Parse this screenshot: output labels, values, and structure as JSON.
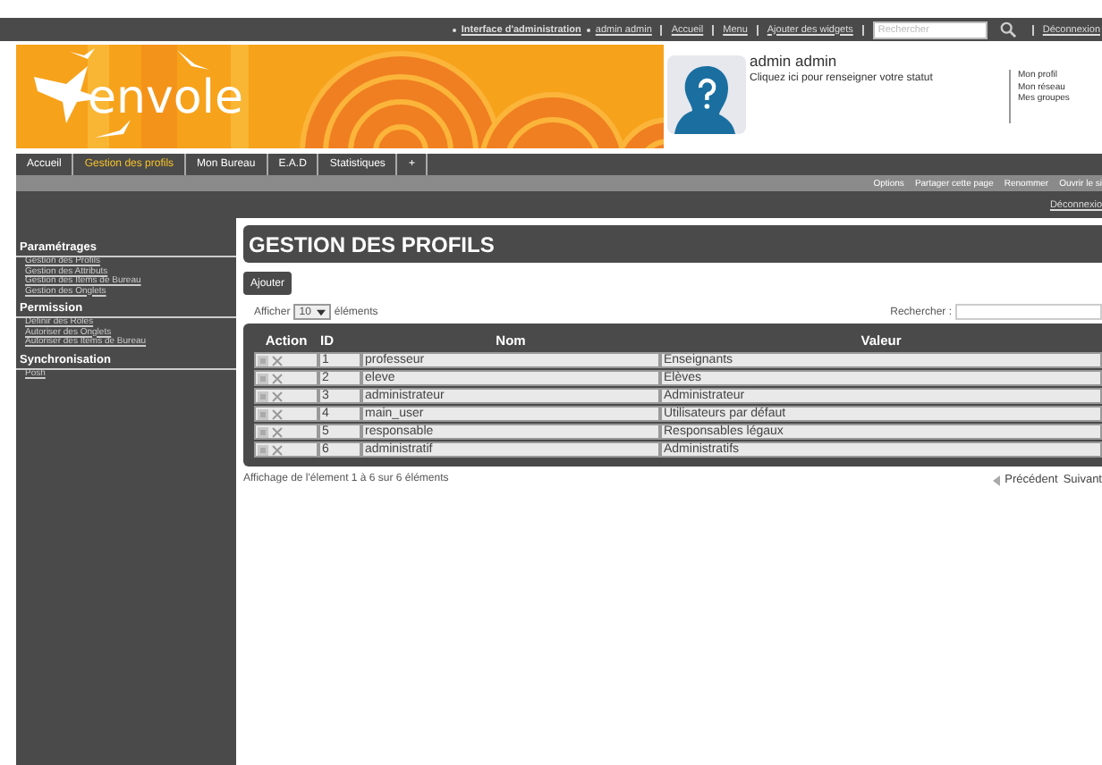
{
  "top_bar": {
    "links": [
      {
        "label": "Interface d'administration",
        "bold": true
      },
      {
        "label": "admin admin",
        "bold": false
      }
    ],
    "menu": [
      "Accueil",
      "Menu",
      "Ajouter des widgets"
    ],
    "search": {
      "placeholder": "Rechercher"
    },
    "logout": "Déconnexion"
  },
  "header": {
    "logo": "envole",
    "user_name": "admin admin",
    "status_prompt": "Cliquez ici pour renseigner votre statut",
    "user_links": [
      "Mon profil",
      "Mon réseau",
      "Mes groupes"
    ]
  },
  "tabs": [
    {
      "label": "Accueil",
      "selected": false
    },
    {
      "label": "Gestion des profils",
      "selected": true
    },
    {
      "label": "Mon Bureau",
      "selected": false
    },
    {
      "label": "E.A.D",
      "selected": false
    },
    {
      "label": "Statistiques",
      "selected": false
    },
    {
      "label": "+",
      "selected": false
    }
  ],
  "page_actions": [
    "Options",
    "Partager cette page",
    "Renommer",
    "Ouvrir le si"
  ],
  "logout_link": "Déconnexio",
  "sidebar": {
    "sections": [
      {
        "title": "Paramétrages",
        "items": [
          "Gestion des Profils",
          "Gestion des Attributs",
          "Gestion des Items de Bureau",
          "Gestion des Onglets"
        ]
      },
      {
        "title": "Permission",
        "items": [
          "Définir des Rôles",
          "Autoriser des Onglets",
          "Autoriser des Items de Bureau"
        ]
      },
      {
        "title": "Synchronisation",
        "items": [
          "Posh"
        ]
      }
    ]
  },
  "main": {
    "title": "GESTION DES PROFILS",
    "add_button": "Ajouter",
    "show_label": "Afficher",
    "page_size": "10",
    "entries_label": "éléments",
    "search_label": "Rechercher :",
    "table": {
      "columns": [
        "Action",
        "ID",
        "Nom",
        "Valeur"
      ],
      "rows": [
        {
          "id": "1",
          "nom": "professeur",
          "valeur": "Enseignants"
        },
        {
          "id": "2",
          "nom": "eleve",
          "valeur": "Elèves"
        },
        {
          "id": "3",
          "nom": "administrateur",
          "valeur": "Administrateur"
        },
        {
          "id": "4",
          "nom": "main_user",
          "valeur": "Utilisateurs par défaut"
        },
        {
          "id": "5",
          "nom": "responsable",
          "valeur": "Responsables légaux"
        },
        {
          "id": "6",
          "nom": "administratif",
          "valeur": "Administratifs"
        }
      ]
    },
    "info": "Affichage de l'élement 1 à 6 sur 6 éléments",
    "prev": "Précédent",
    "next": "Suivant"
  }
}
